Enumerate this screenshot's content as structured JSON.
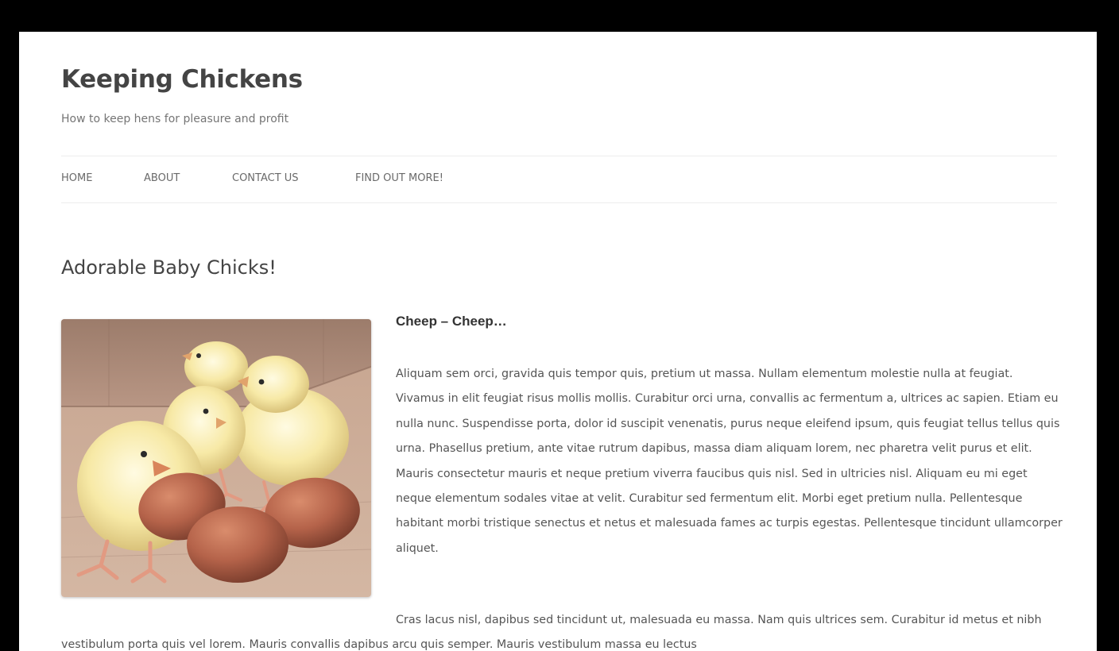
{
  "site": {
    "title": "Keeping Chickens",
    "description": "How to keep hens for pleasure and profit"
  },
  "nav": {
    "items": [
      {
        "label": "HOME"
      },
      {
        "label": "ABOUT"
      },
      {
        "label": "CONTACT US"
      },
      {
        "label": "FIND OUT MORE!"
      }
    ]
  },
  "post": {
    "title": "Adorable Baby Chicks!",
    "image_subject": "yellow baby chicks standing beside brown eggs",
    "subheading": "Cheep – Cheep…",
    "paragraph_1": "Aliquam sem orci, gravida quis tempor quis, pretium ut massa. Nullam elementum molestie nulla at feugiat. Vivamus in elit feugiat risus mollis mollis. Curabitur orci urna, convallis ac fermentum a, ultrices ac sapien. Etiam eu nulla nunc. Suspendisse porta, dolor id suscipit venenatis, purus neque eleifend ipsum, quis feugiat tellus tellus quis urna. Phasellus pretium, ante vitae rutrum dapibus, massa diam aliquam lorem, nec pharetra velit purus et elit. Mauris consectetur mauris et neque pretium viverra faucibus quis nisl. Sed in ultricies nisl. Aliquam eu mi eget neque elementum sodales vitae at velit. Curabitur sed fermentum elit. Morbi eget pretium nulla. Pellentesque habitant morbi tristique senectus et netus et malesuada fames ac turpis egestas. Pellentesque tincidunt ullamcorper aliquet.",
    "paragraph_2": "Cras lacus nisl, dapibus sed tincidunt ut, malesuada eu massa. Nam quis ultrices sem. Curabitur id metus et nibh vestibulum porta quis vel lorem. Mauris convallis dapibus arcu quis semper. Mauris vestibulum massa eu lectus"
  },
  "colors": {
    "frame": "#000000",
    "page_background": "#ffffff",
    "title_text": "#444444",
    "body_text": "#555555",
    "nav_text": "#6a6a6a",
    "divider": "#ededed"
  }
}
